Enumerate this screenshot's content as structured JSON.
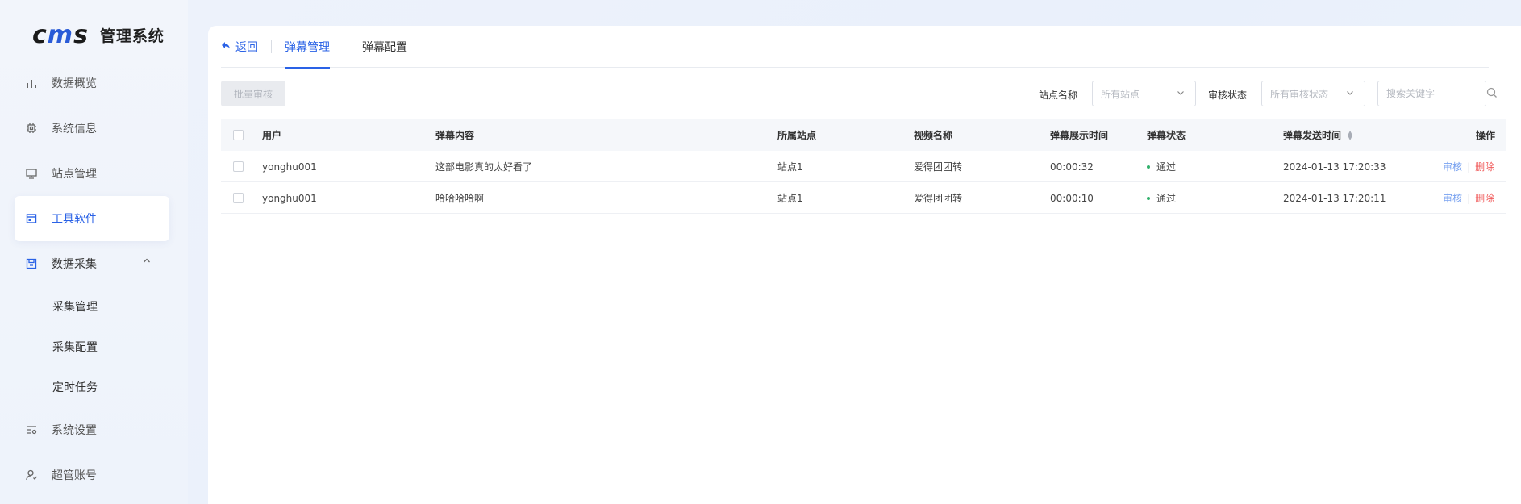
{
  "app": {
    "logo_mark_left": "c",
    "logo_mark_mid": "m",
    "logo_mark_right": "s",
    "title": "管理系统"
  },
  "sidebar": {
    "items": [
      {
        "label": "数据概览",
        "icon": "bar-chart-icon"
      },
      {
        "label": "系统信息",
        "icon": "chip-icon"
      },
      {
        "label": "站点管理",
        "icon": "monitor-icon"
      },
      {
        "label": "工具软件",
        "icon": "window-icon",
        "active": true
      },
      {
        "label": "数据采集",
        "icon": "save-icon",
        "expanded": true
      },
      {
        "label": "系统设置",
        "icon": "settings-list-icon"
      },
      {
        "label": "超管账号",
        "icon": "user-icon"
      }
    ],
    "sub_items": [
      "采集管理",
      "采集配置",
      "定时任务"
    ]
  },
  "tabs": {
    "back_label": "返回",
    "items": [
      {
        "label": "弹幕管理",
        "active": true
      },
      {
        "label": "弹幕配置",
        "active": false
      }
    ]
  },
  "toolbar": {
    "batch_review_label": "批量审核",
    "site_label": "站点名称",
    "site_placeholder": "所有站点",
    "status_label": "审核状态",
    "status_placeholder": "所有审核状态",
    "search_placeholder": "搜索关键字"
  },
  "table": {
    "columns": [
      "用户",
      "弹幕内容",
      "所属站点",
      "视频名称",
      "弹幕展示时间",
      "弹幕状态",
      "弹幕发送时间",
      "操作"
    ],
    "rows": [
      {
        "user": "yonghu001",
        "content": "这部电影真的太好看了",
        "site": "站点1",
        "video": "爱得团团转",
        "show_time": "00:00:32",
        "status": "通过",
        "send_time": "2024-01-13 17:20:33"
      },
      {
        "user": "yonghu001",
        "content": "哈哈哈哈啊",
        "site": "站点1",
        "video": "爱得团团转",
        "show_time": "00:00:10",
        "status": "通过",
        "send_time": "2024-01-13 17:20:11"
      }
    ],
    "op_review": "审核",
    "op_delete": "删除"
  },
  "colors": {
    "accent": "#2a62e6",
    "success": "#32b16c",
    "danger": "#f05a5a"
  }
}
